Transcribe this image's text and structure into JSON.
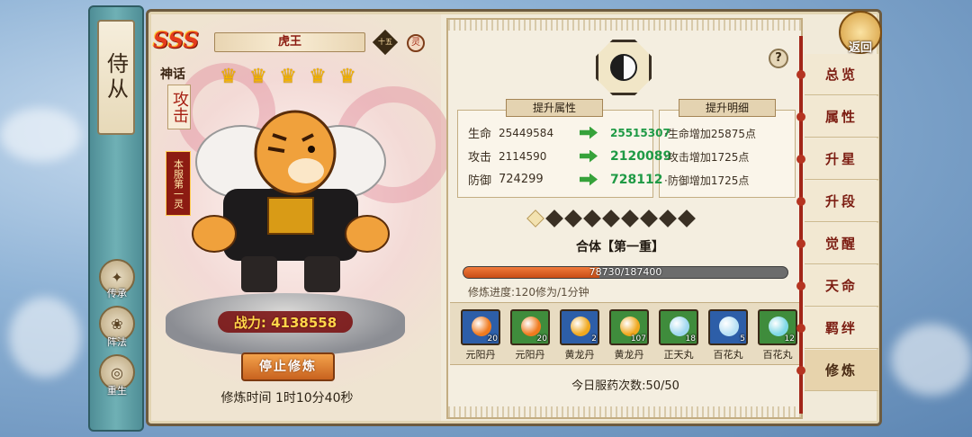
{
  "colors": {
    "accent": "#a22518",
    "progress": "#e26a2c",
    "stat_up": "#1f9a45"
  },
  "sidebar": {
    "title": "侍从",
    "buttons": [
      {
        "label": "传承",
        "icon": "inheritance-icon"
      },
      {
        "label": "阵法",
        "icon": "formation-icon"
      },
      {
        "label": "重生",
        "icon": "rebirth-icon"
      }
    ]
  },
  "hero": {
    "grade": "SSS",
    "grade_label": "神话",
    "name": "虎王",
    "tag_diamond": "十五",
    "tag_circle": "灵",
    "type": "攻击",
    "rank": "本服第一灵",
    "stars": 5,
    "power_label": "战力: 4138558",
    "stop_button": "停止修炼",
    "train_time": "修炼时间 1时10分40秒"
  },
  "stats_panel": {
    "title": "提升属性",
    "rows": [
      {
        "name": "生命",
        "old": "25449584",
        "new": "25515307"
      },
      {
        "name": "攻击",
        "old": "2114590",
        "new": "2120089"
      },
      {
        "name": "防御",
        "old": "724299",
        "new": "728112"
      }
    ]
  },
  "detail_panel": {
    "title": "提升明细",
    "rows": [
      "·生命增加25875点",
      "·攻击增加1725点",
      "·防御增加1725点"
    ]
  },
  "merge": {
    "level_total": 9,
    "level_current": 1,
    "title": "合体【第一重】",
    "progress_text": "78730/187400",
    "progress_value": 78730,
    "progress_max": 187400,
    "train_progress": "修炼进度:120修为/1分钟"
  },
  "items": [
    {
      "name": "元阳丹",
      "count": "20",
      "bg": "#2d5ea8",
      "orb": "#f07a1e"
    },
    {
      "name": "元阳丹",
      "count": "20",
      "bg": "#3f8c3c",
      "orb": "#f07a1e"
    },
    {
      "name": "黄龙丹",
      "count": "2",
      "bg": "#2d5ea8",
      "orb": "#f0a81e"
    },
    {
      "name": "黄龙丹",
      "count": "107",
      "bg": "#3f8c3c",
      "orb": "#f0a81e"
    },
    {
      "name": "正天丸",
      "count": "18",
      "bg": "#3f8c3c",
      "orb": "#9fd7ef"
    },
    {
      "name": "百花丸",
      "count": "5",
      "bg": "#2d5ea8",
      "orb": "#b9e1f5"
    },
    {
      "name": "百花丸",
      "count": "12",
      "bg": "#3f8c3c",
      "orb": "#7fd8e6"
    }
  ],
  "pill_count": "今日服药次数:50/50",
  "tabs": [
    "总览",
    "属性",
    "升星",
    "升段",
    "觉醒",
    "天命",
    "羁绊",
    "修炼"
  ],
  "active_tab": 7,
  "return_label": "返回",
  "help_label": "?"
}
